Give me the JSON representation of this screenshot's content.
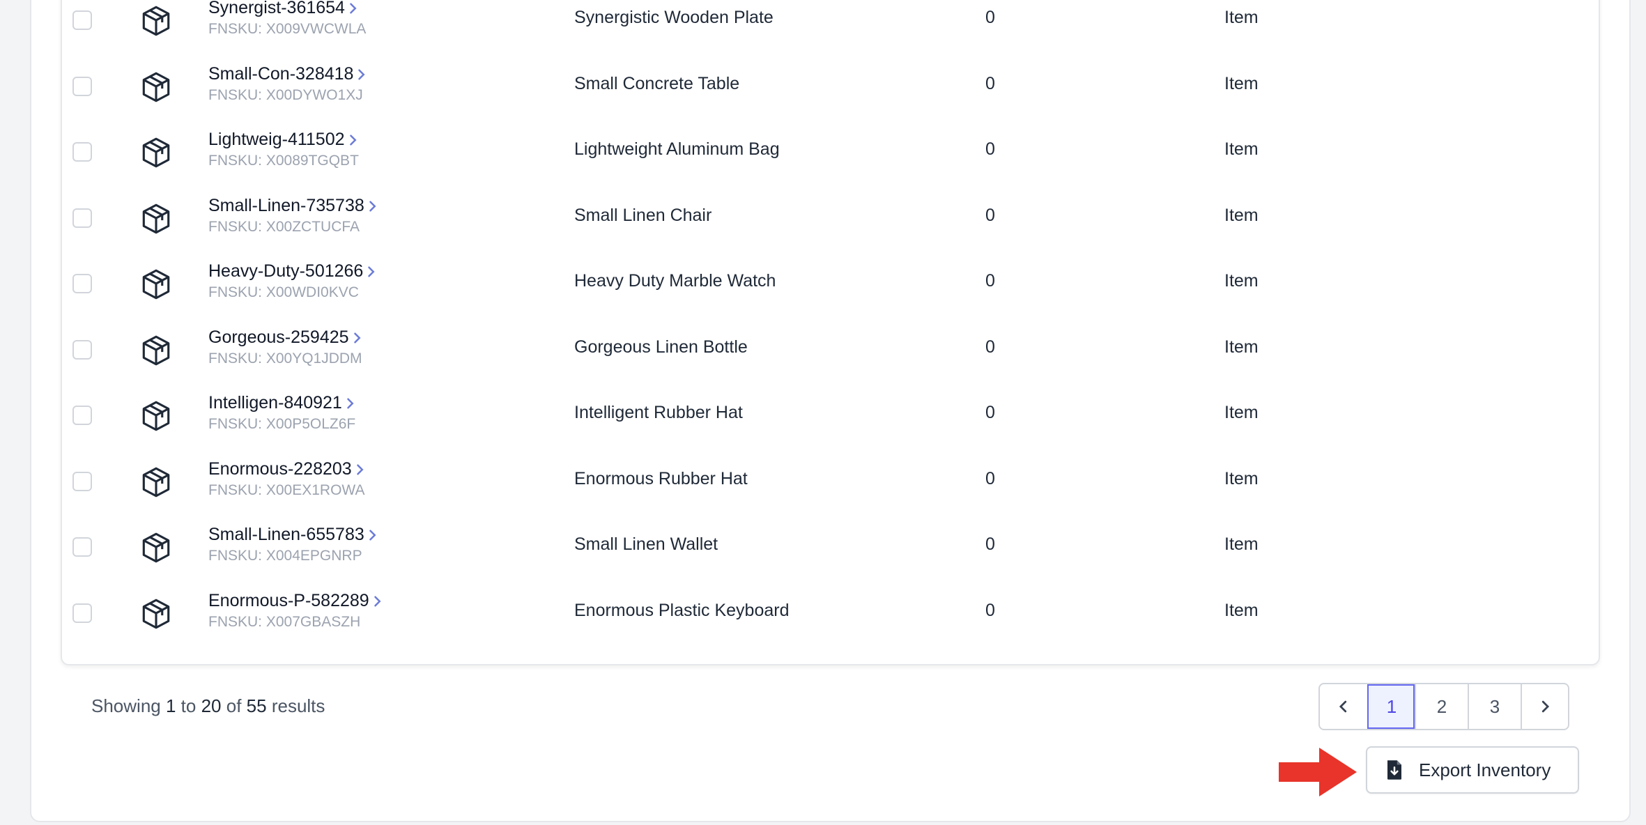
{
  "table": {
    "rows": [
      {
        "sku": "Synergist-361654",
        "fnsku": "FNSKU: X009VWCWLA",
        "title": "Synergistic Wooden Plate",
        "qty": "0",
        "type": "Item"
      },
      {
        "sku": "Small-Con-328418",
        "fnsku": "FNSKU: X00DYWO1XJ",
        "title": "Small Concrete Table",
        "qty": "0",
        "type": "Item"
      },
      {
        "sku": "Lightweig-411502",
        "fnsku": "FNSKU: X0089TGQBT",
        "title": "Lightweight Aluminum Bag",
        "qty": "0",
        "type": "Item"
      },
      {
        "sku": "Small-Linen-735738",
        "fnsku": "FNSKU: X00ZCTUCFA",
        "title": "Small Linen Chair",
        "qty": "0",
        "type": "Item"
      },
      {
        "sku": "Heavy-Duty-501266",
        "fnsku": "FNSKU: X00WDI0KVC",
        "title": "Heavy Duty Marble Watch",
        "qty": "0",
        "type": "Item"
      },
      {
        "sku": "Gorgeous-259425",
        "fnsku": "FNSKU: X00YQ1JDDM",
        "title": "Gorgeous Linen Bottle",
        "qty": "0",
        "type": "Item"
      },
      {
        "sku": "Intelligen-840921",
        "fnsku": "FNSKU: X00P5OLZ6F",
        "title": "Intelligent Rubber Hat",
        "qty": "0",
        "type": "Item"
      },
      {
        "sku": "Enormous-228203",
        "fnsku": "FNSKU: X00EX1ROWA",
        "title": "Enormous Rubber Hat",
        "qty": "0",
        "type": "Item"
      },
      {
        "sku": "Small-Linen-655783",
        "fnsku": "FNSKU: X004EPGNRP",
        "title": "Small Linen Wallet",
        "qty": "0",
        "type": "Item"
      },
      {
        "sku": "Enormous-P-582289",
        "fnsku": "FNSKU: X007GBASZH",
        "title": "Enormous Plastic Keyboard",
        "qty": "0",
        "type": "Item"
      }
    ]
  },
  "footer": {
    "showing_prefix": "Showing",
    "from": "1",
    "to_word": "to",
    "to": "20",
    "of_word": "of",
    "total": "55",
    "results_word": "results"
  },
  "pagination": {
    "pages": [
      "1",
      "2",
      "3"
    ],
    "current": "1"
  },
  "export": {
    "label": "Export Inventory"
  },
  "colors": {
    "accent": "#4f46e5",
    "annotation_arrow": "#e8342a"
  }
}
